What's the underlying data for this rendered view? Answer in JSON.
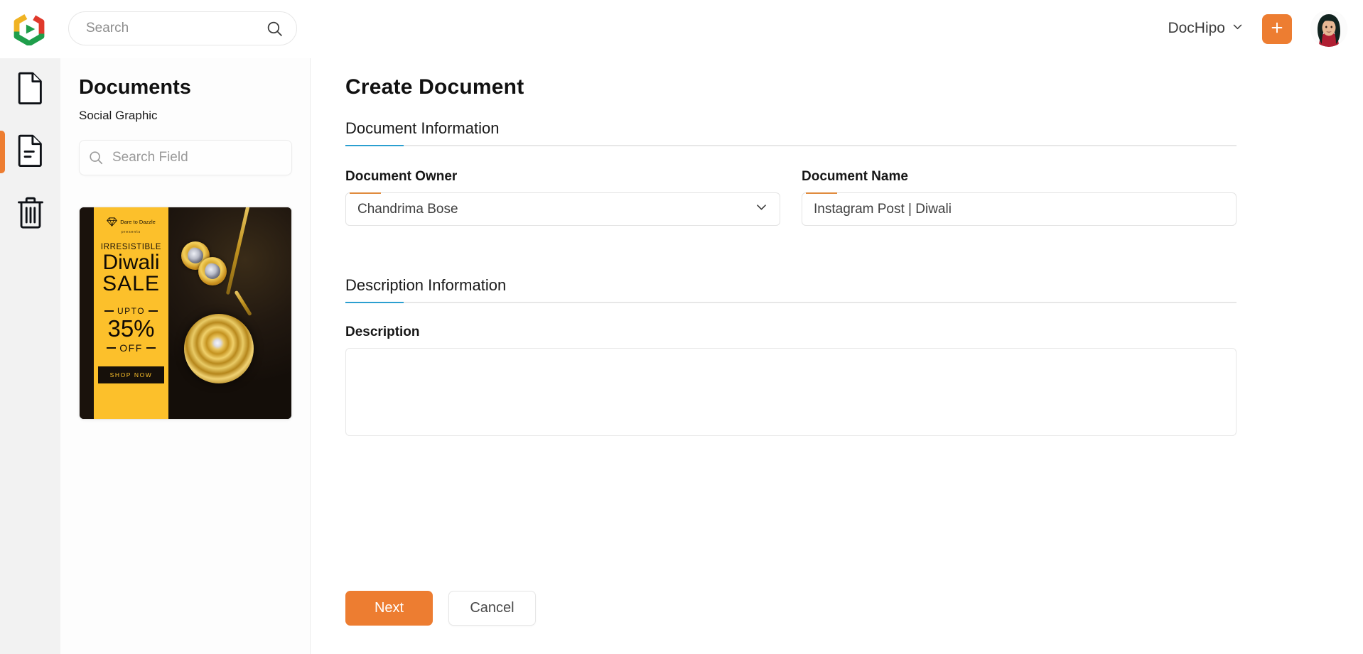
{
  "app": {
    "brand": "DocHipo",
    "logo_icon": "dochipo-hexagon-play-logo",
    "colors": {
      "accent_orange": "#ed7d31",
      "section_accent_blue": "#2b9fd0",
      "field_accent_orange": "#e08b3e",
      "rail_background": "#f2f2f2"
    }
  },
  "topbar": {
    "search": {
      "placeholder": "Search",
      "value": "",
      "icon": "search-icon"
    },
    "brand_menu": {
      "label": "DocHipo",
      "chevron_icon": "chevron-down-icon"
    },
    "create_button": {
      "label": "+",
      "icon": "plus-icon"
    },
    "avatar": {
      "alt": "user-avatar"
    }
  },
  "rail": {
    "items": [
      {
        "name": "new-document",
        "icon": "document-blank-icon",
        "active": false
      },
      {
        "name": "my-documents",
        "icon": "document-lines-icon",
        "active": true
      },
      {
        "name": "trash",
        "icon": "trash-icon",
        "active": false
      }
    ]
  },
  "docs_panel": {
    "title": "Documents",
    "subtitle": "Social Graphic",
    "search": {
      "placeholder": "Search Field",
      "value": "",
      "icon": "search-icon"
    },
    "thumbnail": {
      "name": "diwali-sale-social-graphic",
      "brand": "Dare to Dazzle",
      "presents": "presents",
      "headline_small": "IRRESISTIBLE",
      "headline_1": "Diwali",
      "headline_2": "SALE",
      "upto": "UPTO",
      "percent": "35%",
      "off": "OFF",
      "cta": "SHOP NOW"
    }
  },
  "main": {
    "page_title": "Create Document",
    "sections": [
      {
        "id": "document-information",
        "heading": "Document Information",
        "fields": [
          {
            "id": "document-owner",
            "label": "Document Owner",
            "type": "select",
            "value": "Chandrima Bose",
            "placeholder": "",
            "chevron_icon": "chevron-down-icon"
          },
          {
            "id": "document-name",
            "label": "Document Name",
            "type": "text",
            "value": "Instagram Post | Diwali",
            "placeholder": "Document Name"
          }
        ]
      },
      {
        "id": "description-information",
        "heading": "Description Information",
        "fields": [
          {
            "id": "description",
            "label": "Description",
            "type": "textarea",
            "value": "",
            "placeholder": ""
          }
        ]
      }
    ],
    "actions": {
      "primary_label": "Next",
      "secondary_label": "Cancel"
    }
  }
}
